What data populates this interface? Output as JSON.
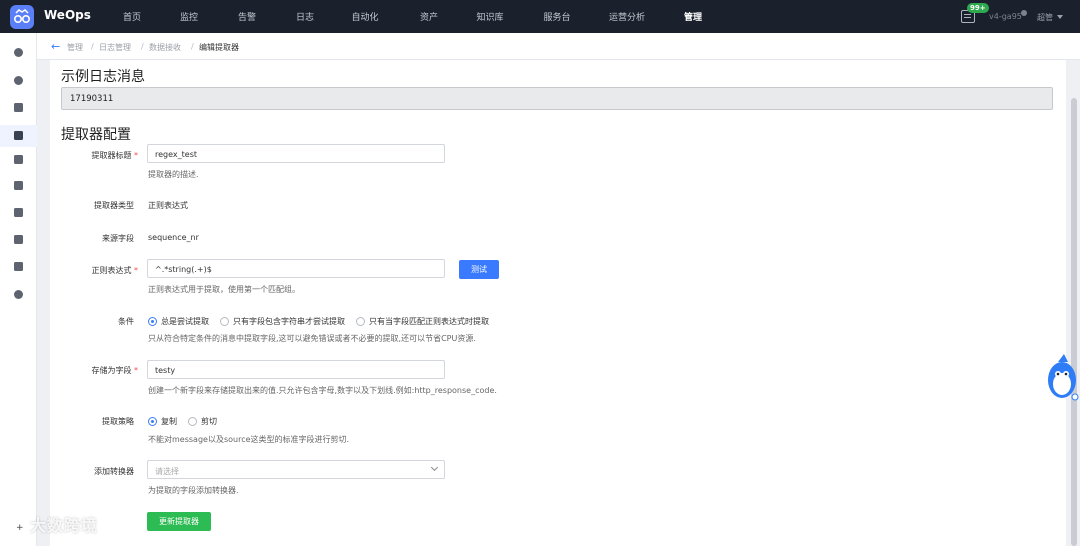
{
  "app": {
    "brand": "WeOps"
  },
  "nav": {
    "items": [
      "首页",
      "监控",
      "告警",
      "日志",
      "自动化",
      "资产",
      "知识库",
      "服务台",
      "运营分析",
      "管理"
    ],
    "active_index": 9
  },
  "header": {
    "badge": "99+",
    "version": "v4-ga95",
    "user": "超管"
  },
  "breadcrumb": {
    "items": [
      "管理",
      "日志管理",
      "数据接收"
    ],
    "current": "编辑提取器"
  },
  "sample": {
    "heading": "示例日志消息",
    "value": "17190311"
  },
  "config": {
    "heading": "提取器配置",
    "title_label": "提取器标题",
    "title_value": "regex_test",
    "title_hint": "提取器的描述.",
    "type_label": "提取器类型",
    "type_value": "正则表达式",
    "source_label": "来源字段",
    "source_value": "sequence_nr",
    "regex_label": "正则表达式",
    "regex_value": "^.*string(.+)$",
    "test_button": "测试",
    "regex_hint": "正则表达式用于提取，使用第一个匹配组。",
    "condition_label": "条件",
    "condition_options": [
      "总是尝试提取",
      "只有字段包含字符串才尝试提取",
      "只有当字段匹配正则表达式时提取"
    ],
    "condition_selected": 0,
    "condition_hint": "只从符合特定条件的消息中提取字段,这可以避免错误或者不必要的提取,还可以节省CPU资源.",
    "store_label": "存储为字段",
    "store_value": "testy",
    "store_hint": "创建一个新字段来存储提取出来的值.只允许包含字母,数字以及下划线.例如:http_response_code.",
    "strategy_label": "提取策略",
    "strategy_options": [
      "复制",
      "剪切"
    ],
    "strategy_selected": 0,
    "strategy_hint": "不能对message以及source这类型的标准字段进行剪切.",
    "converter_label": "添加转换器",
    "converter_placeholder": "请选择",
    "converter_hint": "为提取的字段添加转换器.",
    "update_button": "更新提取器"
  },
  "watermark": "大数跨境",
  "colors": {
    "primary": "#3a7afe",
    "success": "#2dbb53",
    "topbar": "#1b212c"
  }
}
